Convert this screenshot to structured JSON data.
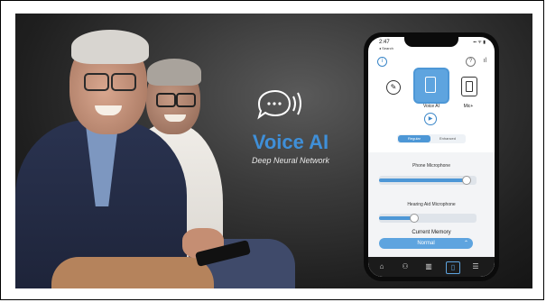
{
  "hero": {
    "title": "Voice AI",
    "subtitle": "Deep Neural Network",
    "title_color": "#3f8fd8",
    "icon": "speech-bubble-sound-icon"
  },
  "phone": {
    "status_time": "2:47",
    "back_label": "◂ Search",
    "status_right": "▪▪ ᯤ ▮",
    "mode_buttons": [
      {
        "label": "Voice AI",
        "icon": "phone-voice-icon",
        "selected": true
      },
      {
        "label": "Mic+",
        "icon": "phone-mic-icon",
        "selected": false
      }
    ],
    "segment": [
      "Regular",
      "Enhanced"
    ],
    "phone_mic_label": "Phone Microphone",
    "phone_mic_level": 0.9,
    "ha_mic_label": "Hearing Aid Microphone",
    "ha_mic_level": 0.35,
    "memory_label": "Current Memory",
    "memory_value": "Normal",
    "nav": [
      "home-icon",
      "people-icon",
      "equalizer-icon",
      "hearing-aid-icon",
      "menu-icon"
    ],
    "accent": "#5ea4df"
  }
}
